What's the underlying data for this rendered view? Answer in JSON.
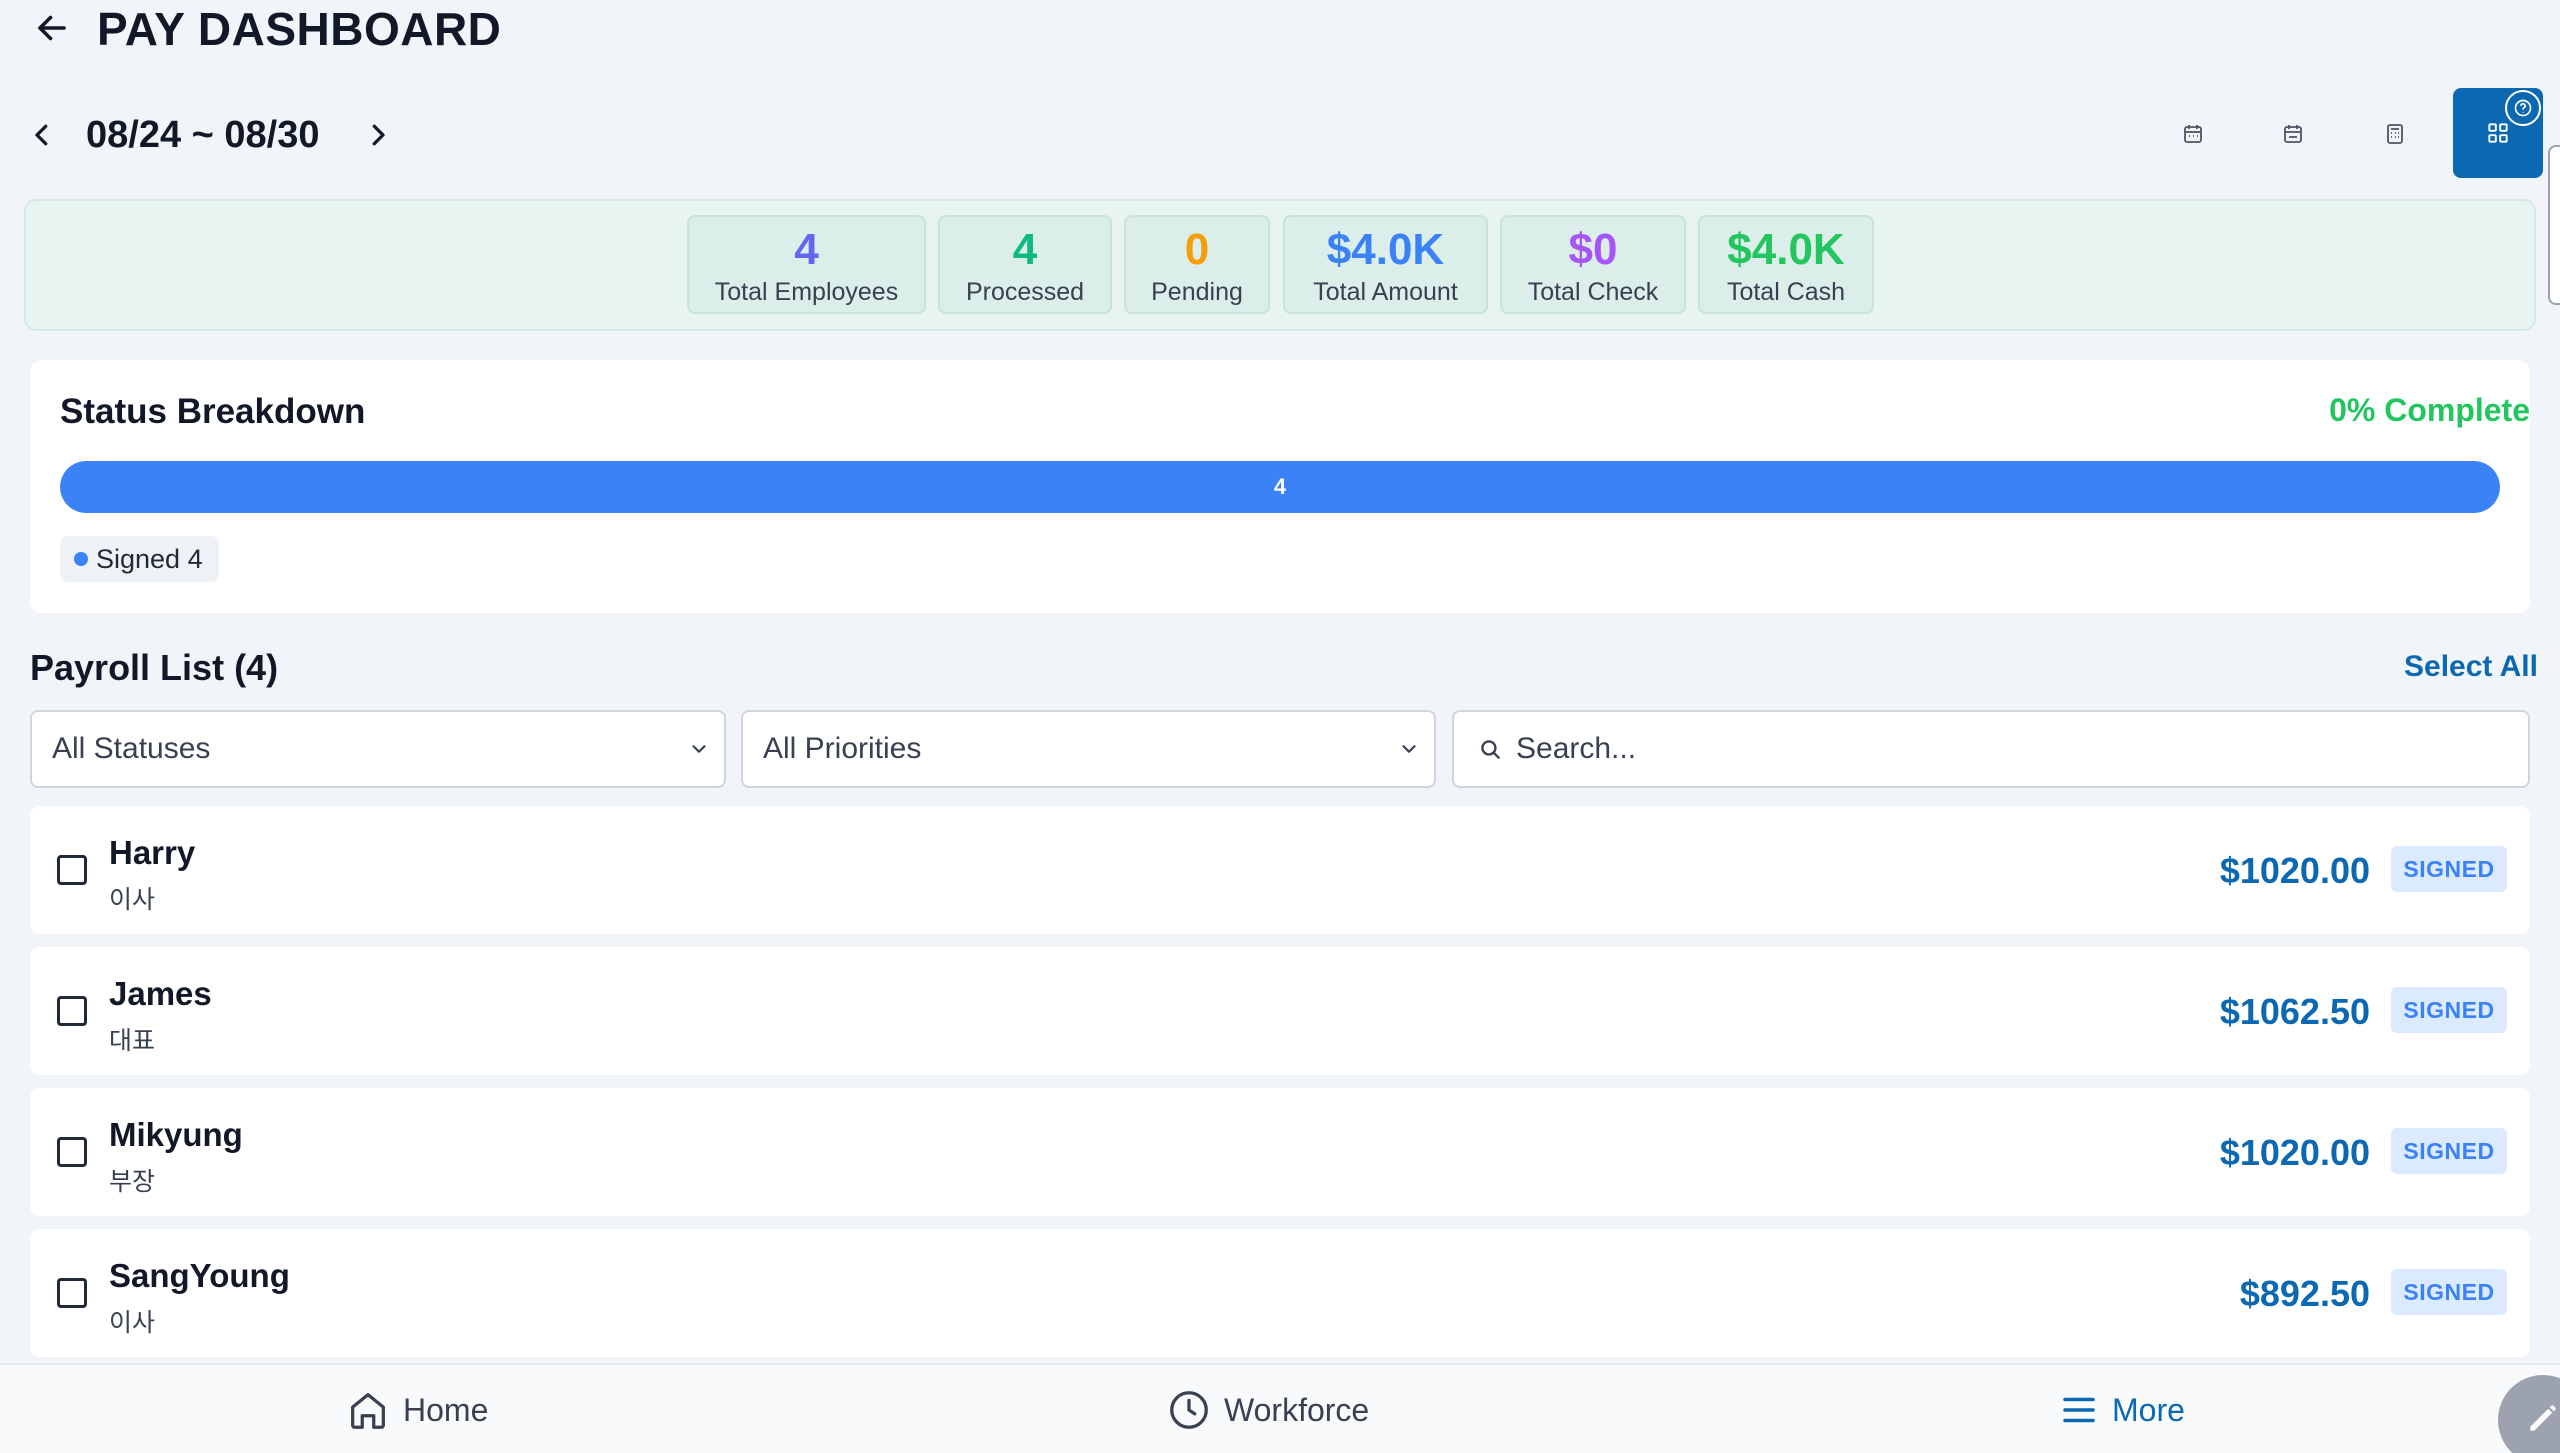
{
  "header": {
    "title": "PAY DASHBOARD",
    "back_icon": "arrow-left-icon"
  },
  "date_nav": {
    "range": "08/24 ~ 08/30"
  },
  "view_modes": [
    "calendar-week-icon",
    "calendar-day-icon",
    "calculator-icon",
    "grid-icon"
  ],
  "stats": [
    {
      "value": "4",
      "label": "Total Employees",
      "color": "#6366f1"
    },
    {
      "value": "4",
      "label": "Processed",
      "color": "#10b981"
    },
    {
      "value": "0",
      "label": "Pending",
      "color": "#f59e0b"
    },
    {
      "value": "$4.0K",
      "label": "Total Amount",
      "color": "#3b82f6"
    },
    {
      "value": "$0",
      "label": "Total Check",
      "color": "#a855f7"
    },
    {
      "value": "$4.0K",
      "label": "Total Cash",
      "color": "#22c55e"
    }
  ],
  "status_breakdown": {
    "title": "Status Breakdown",
    "complete": "0% Complete",
    "bar_value": "4",
    "signed_fraction": 1.0,
    "legend": "Signed 4",
    "legend_color": "#3b82f6"
  },
  "payroll": {
    "title": "Payroll List (4)",
    "select_all": "Select All",
    "status_filter": "All Statuses",
    "priority_filter": "All Priorities",
    "search_placeholder": "Search...",
    "rows": [
      {
        "name": "Harry",
        "role": "이사",
        "amount": "$1020.00",
        "status": "SIGNED"
      },
      {
        "name": "James",
        "role": "대표",
        "amount": "$1062.50",
        "status": "SIGNED"
      },
      {
        "name": "Mikyung",
        "role": "부장",
        "amount": "$1020.00",
        "status": "SIGNED"
      },
      {
        "name": "SangYoung",
        "role": "이사",
        "amount": "$892.50",
        "status": "SIGNED"
      }
    ]
  },
  "tabs": {
    "home": "Home",
    "workforce": "Workforce",
    "more": "More"
  },
  "colors": {
    "accent": "#0b68b1",
    "progress": "#3b82f6",
    "complete": "#22c55e"
  }
}
